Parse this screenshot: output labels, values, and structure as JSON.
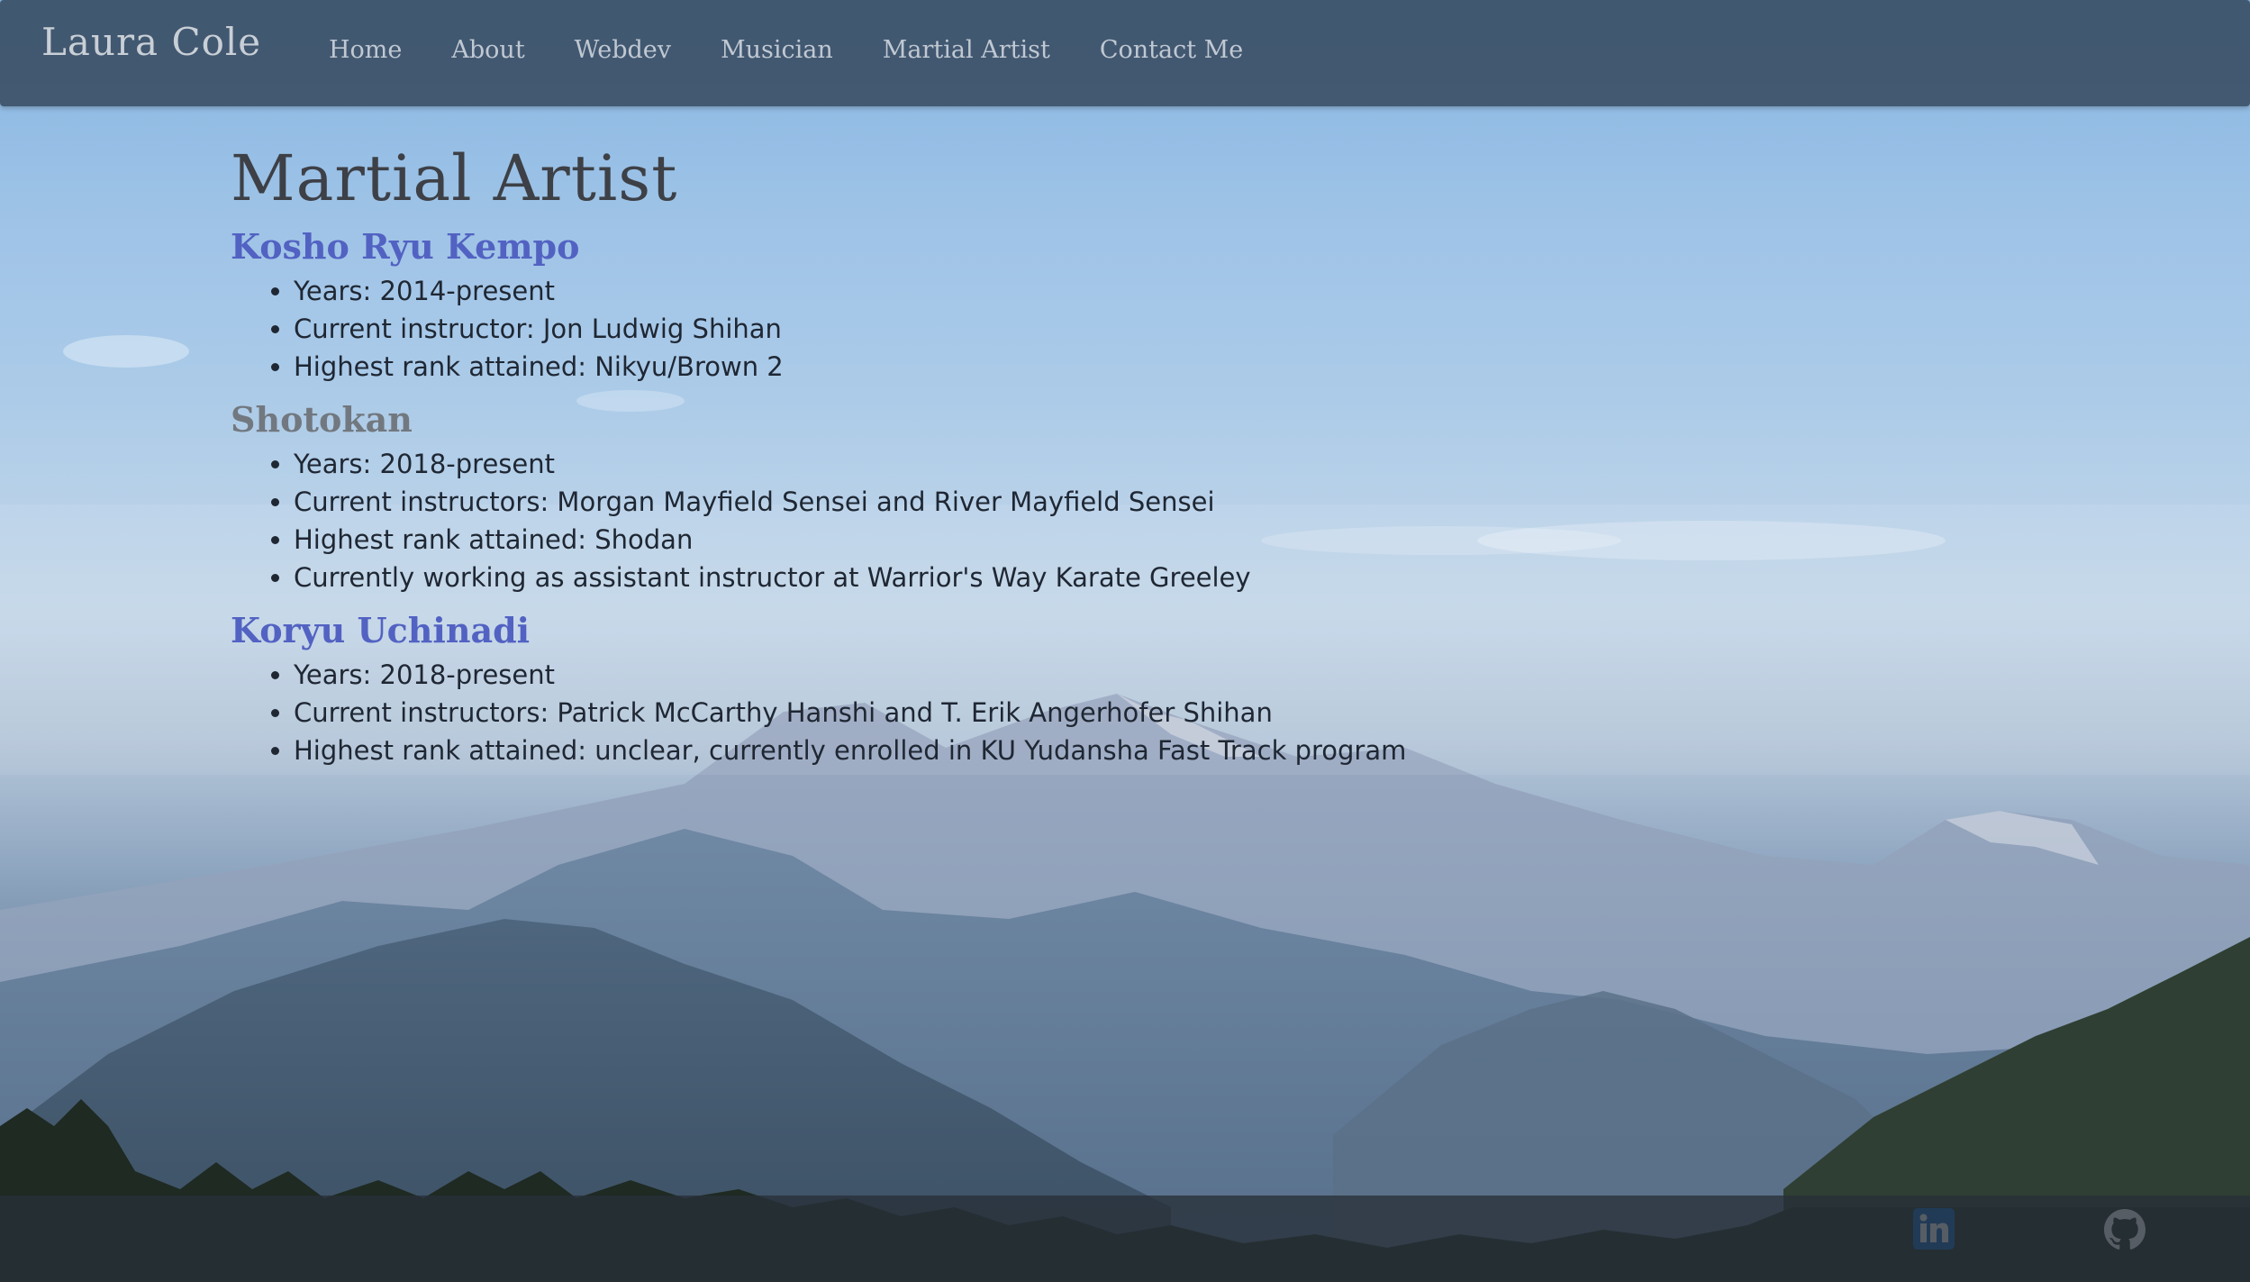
{
  "navbar": {
    "brand": "Laura Cole",
    "links": [
      "Home",
      "About",
      "Webdev",
      "Musician",
      "Martial Artist",
      "Contact Me"
    ]
  },
  "page": {
    "title": "Martial Artist",
    "sections": [
      {
        "title": "Kosho Ryu Kempo",
        "items": [
          "Years: 2014-present",
          "Current instructor: Jon Ludwig Shihan",
          "Highest rank attained: Nikyu/Brown 2"
        ]
      },
      {
        "title": "Shotokan",
        "items": [
          "Years: 2018-present",
          "Current instructors: Morgan Mayfield Sensei and River Mayfield Sensei",
          "Highest rank attained: Shodan",
          "Currently working as assistant instructor at Warrior's Way Karate Greeley"
        ]
      },
      {
        "title": "Koryu Uchinadi",
        "items": [
          "Years: 2018-present",
          "Current instructors: Patrick McCarthy Hanshi and T. Erik Angerhofer Shihan",
          "Highest rank attained: unclear, currently enrolled in KU Yudansha Fast Track program"
        ]
      }
    ]
  },
  "footer": {
    "icons": [
      "linkedin-icon",
      "github-icon"
    ]
  },
  "colors": {
    "navbar": "#3e546c",
    "heading_blue": "#5262c2",
    "heading_gray": "#72787f",
    "linkedin": "#0a66c2"
  }
}
